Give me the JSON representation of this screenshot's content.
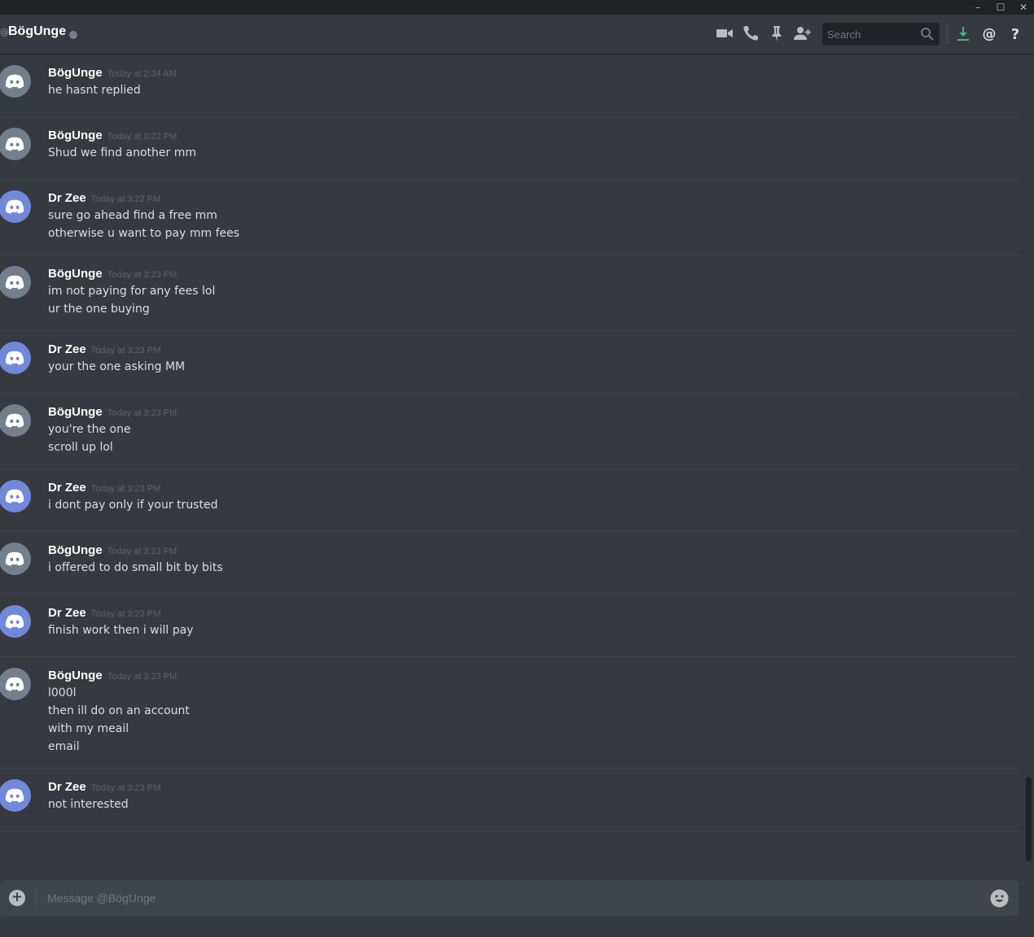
{
  "window": {
    "minimize_glyph": "–",
    "maximize_glyph": "☐",
    "close_glyph": "✕"
  },
  "header": {
    "at_glyph": "@",
    "title": "BögUnge",
    "status_color": "#747f8d",
    "icons": [
      "video-icon",
      "call-icon",
      "pin-icon",
      "add-user-icon",
      "search-icon",
      "download-icon",
      "mention-icon",
      "help-icon"
    ],
    "search_placeholder": "Search"
  },
  "colors": {
    "background": "#36393f",
    "username": "#ffffff",
    "timestamp": "#5f6268",
    "avatar_gray": "#747f8d",
    "avatar_blurple": "#7289da",
    "download_accent": "#43b581"
  },
  "messages": [
    {
      "author": "BögUnge",
      "time": "Today at 2:34 AM",
      "avatar": "gray",
      "lines": [
        "he hasnt replied"
      ]
    },
    {
      "author": "BögUnge",
      "time": "Today at 3:22 PM",
      "avatar": "gray",
      "lines": [
        "Shud we find another mm"
      ]
    },
    {
      "author": "Dr Zee",
      "time": "Today at 3:22 PM",
      "avatar": "blurple",
      "lines": [
        "sure go ahead find a free mm",
        "otherwise u want to pay mm fees"
      ]
    },
    {
      "author": "BögUnge",
      "time": "Today at 3:23 PM",
      "avatar": "gray",
      "lines": [
        "im not paying for any fees lol",
        "ur the one buying"
      ]
    },
    {
      "author": "Dr Zee",
      "time": "Today at 3:23 PM",
      "avatar": "blurple",
      "lines": [
        "your the one asking MM"
      ]
    },
    {
      "author": "BögUnge",
      "time": "Today at 3:23 PM",
      "avatar": "gray",
      "lines": [
        "you're the one",
        "scroll up lol"
      ]
    },
    {
      "author": "Dr Zee",
      "time": "Today at 3:23 PM",
      "avatar": "blurple",
      "lines": [
        "i dont pay only if your trusted"
      ]
    },
    {
      "author": "BögUnge",
      "time": "Today at 3:23 PM",
      "avatar": "gray",
      "lines": [
        "i offered to do small bit by bits"
      ]
    },
    {
      "author": "Dr Zee",
      "time": "Today at 3:23 PM",
      "avatar": "blurple",
      "lines": [
        "finish work then i will pay"
      ]
    },
    {
      "author": "BögUnge",
      "time": "Today at 3:23 PM",
      "avatar": "gray",
      "lines": [
        "l000l",
        "then ill do on an account",
        "with my meail",
        "email"
      ]
    },
    {
      "author": "Dr Zee",
      "time": "Today at 3:23 PM",
      "avatar": "blurple",
      "lines": [
        "not interested"
      ]
    }
  ],
  "composer": {
    "upload_glyph": "+",
    "placeholder": "Message @BögUnge"
  }
}
